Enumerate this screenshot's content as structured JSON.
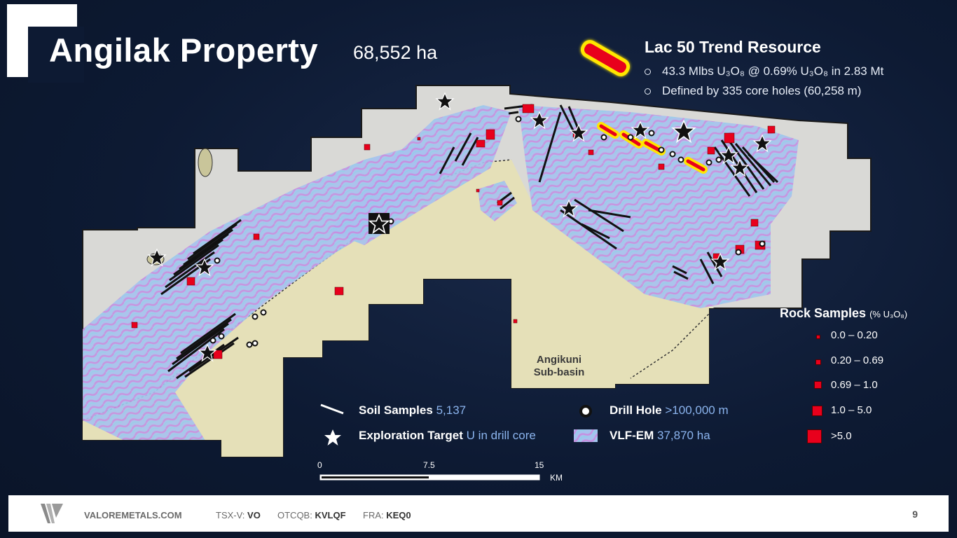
{
  "slide": {
    "title": "Angilak Property",
    "area": "68,552 ha",
    "page_number": "9"
  },
  "lac50": {
    "title": "Lac 50 Trend Resource",
    "bullets": [
      "43.3 Mlbs U₃O₈ @ 0.69% U₃O₈ in 2.83 Mt",
      "Defined by 335 core holes (60,258 m)"
    ]
  },
  "map": {
    "basin_label_line1": "Angikuni",
    "basin_label_line2": "Sub-basin",
    "colors": {
      "property": "#d9d9d6",
      "basin": "#e5e0b8",
      "vlf": "#9fb8ec",
      "rock": "#e8001c",
      "resource_fill": "#e8001c",
      "resource_outline": "#ffe600"
    }
  },
  "legend": {
    "soil": {
      "label": "Soil Samples",
      "value": "5,137"
    },
    "target": {
      "label": "Exploration Target",
      "value": "U in drill core"
    },
    "drill": {
      "label": "Drill Hole",
      "value": ">100,000 m"
    },
    "vlf": {
      "label": "VLF-EM",
      "value": "37,870 ha"
    }
  },
  "rock_samples": {
    "title": "Rock Samples",
    "unit": "(% U₃O₈)",
    "classes": [
      "0.0 – 0.20",
      "0.20 – 0.69",
      "0.69 – 1.0",
      "1.0 – 5.0",
      ">5.0"
    ]
  },
  "scale": {
    "ticks": [
      "0",
      "7.5",
      "15"
    ],
    "unit": "KM"
  },
  "footer": {
    "website": "VALOREMETALS.COM",
    "tickers": [
      {
        "exchange": "TSX-V:",
        "symbol": "VO"
      },
      {
        "exchange": "OTCQB:",
        "symbol": "KVLQF"
      },
      {
        "exchange": "FRA:",
        "symbol": "KEQ0"
      }
    ]
  }
}
